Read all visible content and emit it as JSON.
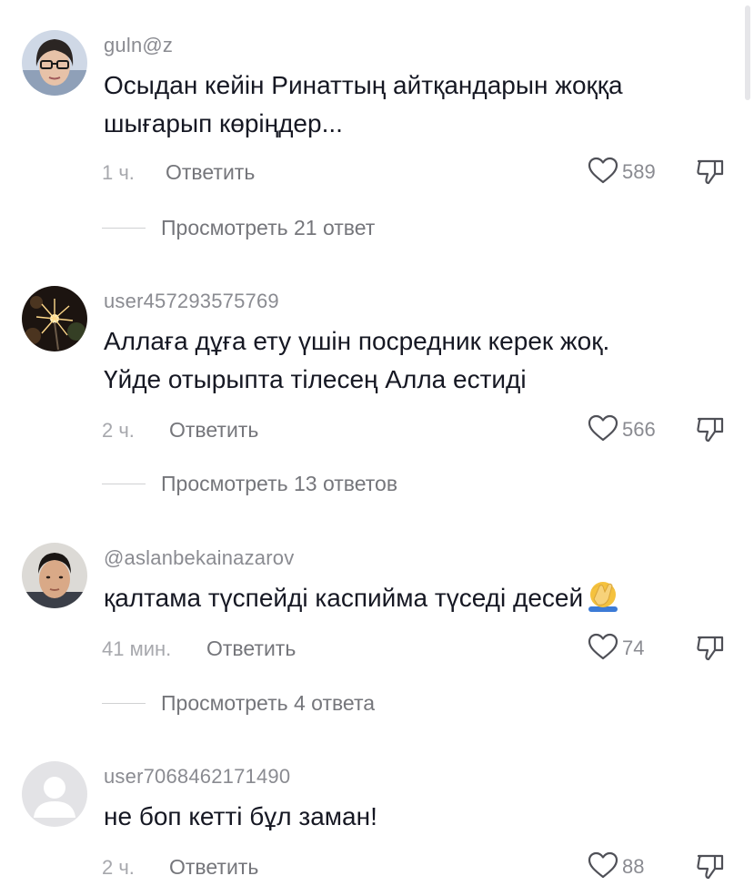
{
  "comments": [
    {
      "username": "guln@z",
      "avatar": "woman-with-glasses-photo",
      "text": "Осыдан кейін Ринаттың айтқандарын жоққа\nшығарып көріңдер...",
      "time": "1 ч.",
      "reply_label": "Ответить",
      "likes": "589",
      "view_replies": "Просмотреть 21 ответ"
    },
    {
      "username": "user457293575769",
      "avatar": "sparkler-photo",
      "text": "Аллаға дұға ету үшін посредник керек жоқ.\nҮйде отырыпта тілесең Алла естиді",
      "time": "2 ч.",
      "reply_label": "Ответить",
      "likes": "566",
      "view_replies": "Просмотреть 13 ответов"
    },
    {
      "username": "@aslanbekainazarov",
      "avatar": "young-man-photo",
      "text": "қалтама түспейді каспийма түседі десей",
      "emoji": "facepalm-emoji",
      "time": "41 мин.",
      "reply_label": "Ответить",
      "likes": "74",
      "view_replies": "Просмотреть 4 ответа"
    },
    {
      "username": "user7068462171490",
      "avatar": "default-avatar",
      "text": "не боп кетті бұл заман!",
      "time": "2 ч.",
      "reply_label": "Ответить",
      "likes": "88"
    }
  ],
  "icons": {
    "like": "heart-outline-icon",
    "dislike": "thumbs-down-outline-icon"
  },
  "colors": {
    "text": "#161823",
    "secondary": "#8a8b91",
    "muted": "#a7a8ad"
  }
}
